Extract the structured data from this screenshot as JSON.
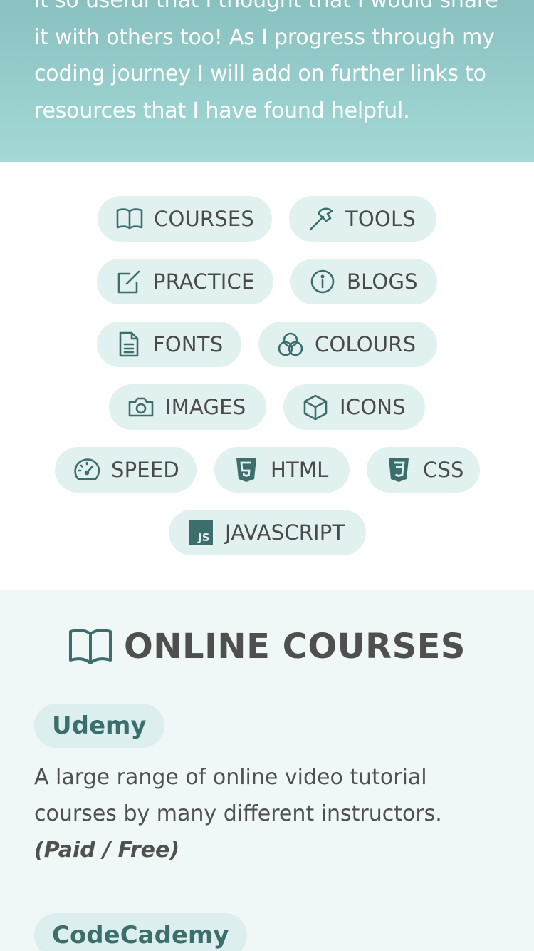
{
  "intro": {
    "text": "it so useful that I thought that I would share it with others too! As I progress through my coding journey I will add on further links to resources that I have found helpful."
  },
  "colors": {
    "accent": "#3c6e6c",
    "pill_bg": "#e0f1f0",
    "hero_top": "#89c1c0",
    "hero_bottom": "#a3d8d6",
    "section_bg": "#eff7f7"
  },
  "nav": {
    "items": [
      {
        "label": "COURSES",
        "icon": "book-icon"
      },
      {
        "label": "TOOLS",
        "icon": "hammer-icon"
      },
      {
        "label": "PRACTICE",
        "icon": "edit-icon"
      },
      {
        "label": "BLOGS",
        "icon": "info-icon"
      },
      {
        "label": "FONTS",
        "icon": "document-icon"
      },
      {
        "label": "COLOURS",
        "icon": "color-circles-icon"
      },
      {
        "label": "IMAGES",
        "icon": "camera-icon"
      },
      {
        "label": "ICONS",
        "icon": "cube-icon"
      },
      {
        "label": "SPEED",
        "icon": "speedometer-icon"
      },
      {
        "label": "HTML",
        "icon": "html5-icon"
      },
      {
        "label": "CSS",
        "icon": "css3-icon"
      },
      {
        "label": "JAVASCRIPT",
        "icon": "javascript-icon"
      }
    ]
  },
  "courses": {
    "title": "ONLINE COURSES",
    "items": [
      {
        "name": "Udemy",
        "description": "A large range of online video tutorial courses by many different instructors.",
        "price": "(Paid / Free)"
      },
      {
        "name": "CodeCademy"
      }
    ]
  }
}
